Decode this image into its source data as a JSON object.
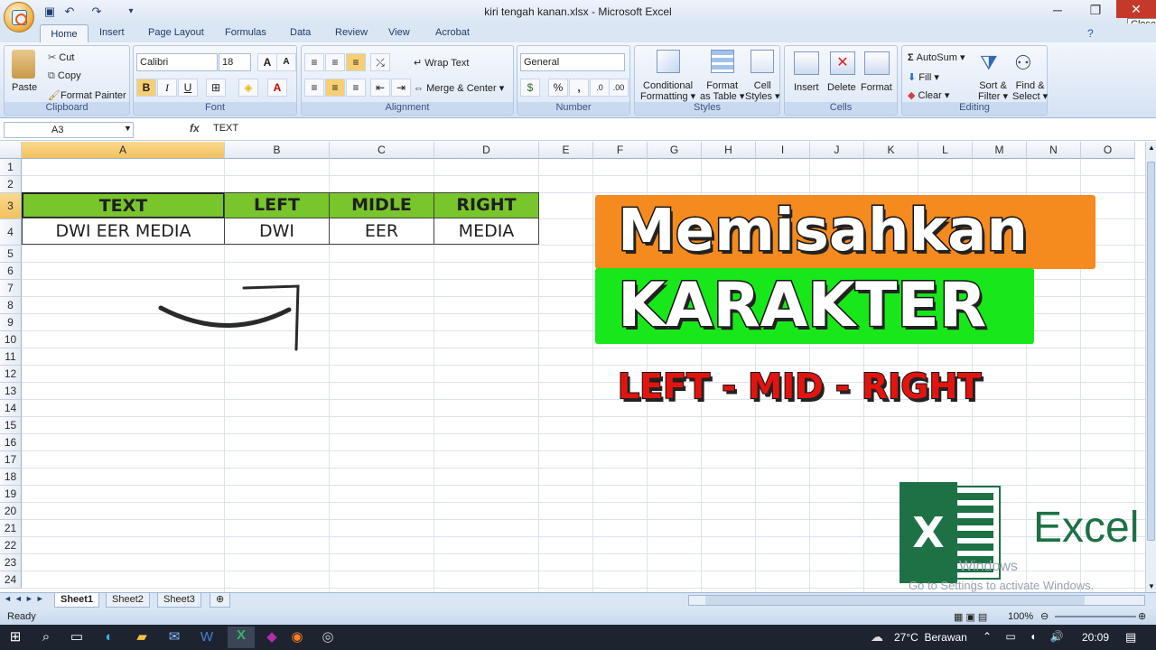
{
  "window": {
    "title": "kiri tengah kanan.xlsx - Microsoft Excel",
    "close_tooltip": "Close"
  },
  "tabs": [
    "Home",
    "Insert",
    "Page Layout",
    "Formulas",
    "Data",
    "Review",
    "View",
    "Acrobat"
  ],
  "clipboard": {
    "paste": "Paste",
    "cut": "Cut",
    "copy": "Copy",
    "format_painter": "Format Painter",
    "label": "Clipboard"
  },
  "font": {
    "name": "Calibri",
    "size": "18",
    "label": "Font"
  },
  "alignment": {
    "wrap": "Wrap Text",
    "merge": "Merge & Center",
    "label": "Alignment"
  },
  "number": {
    "format": "General",
    "label": "Number"
  },
  "styles": {
    "conditional1": "Conditional",
    "conditional2": "Formatting",
    "format_table1": "Format",
    "format_table2": "as Table",
    "cell_styles1": "Cell",
    "cell_styles2": "Styles",
    "label": "Styles"
  },
  "cells": {
    "insert": "Insert",
    "delete": "Delete",
    "format": "Format",
    "label": "Cells"
  },
  "editing": {
    "autosum": "AutoSum",
    "fill": "Fill",
    "clear": "Clear",
    "sort1": "Sort &",
    "sort2": "Filter",
    "find1": "Find &",
    "find2": "Select",
    "label": "Editing"
  },
  "formula_bar": {
    "name_box": "A3",
    "fx": "fx",
    "value": "TEXT"
  },
  "columns": [
    "A",
    "B",
    "C",
    "D",
    "E",
    "F",
    "G",
    "H",
    "I",
    "J",
    "K",
    "L",
    "M",
    "N",
    "O"
  ],
  "rows": [
    "1",
    "2",
    "3",
    "4",
    "5",
    "6",
    "7",
    "8",
    "9",
    "10",
    "11",
    "12",
    "13",
    "14",
    "15",
    "16",
    "17",
    "18",
    "19",
    "20",
    "21",
    "22",
    "23",
    "24"
  ],
  "table": {
    "headers": [
      "TEXT",
      "LEFT",
      "MIDLE",
      "RIGHT"
    ],
    "values": [
      "DWI EER MEDIA",
      "DWI",
      "EER",
      "MEDIA"
    ],
    "header_color": "#78c52c"
  },
  "overlay": {
    "title1": "Memisahkan",
    "title2": "KARAKTER",
    "subtitle": "LEFT - MID - RIGHT",
    "logo_text": "Excel",
    "watermark1": "Windows",
    "watermark2": "Go to Settings to activate Windows.",
    "orange": "#f58a1f",
    "green": "#18e81a",
    "red": "#e3140f"
  },
  "sheets": [
    "Sheet1",
    "Sheet2",
    "Sheet3"
  ],
  "status": {
    "ready": "Ready",
    "zoom": "100%"
  },
  "taskbar": {
    "weather": "27°C  Berawan",
    "time": "20:09"
  }
}
